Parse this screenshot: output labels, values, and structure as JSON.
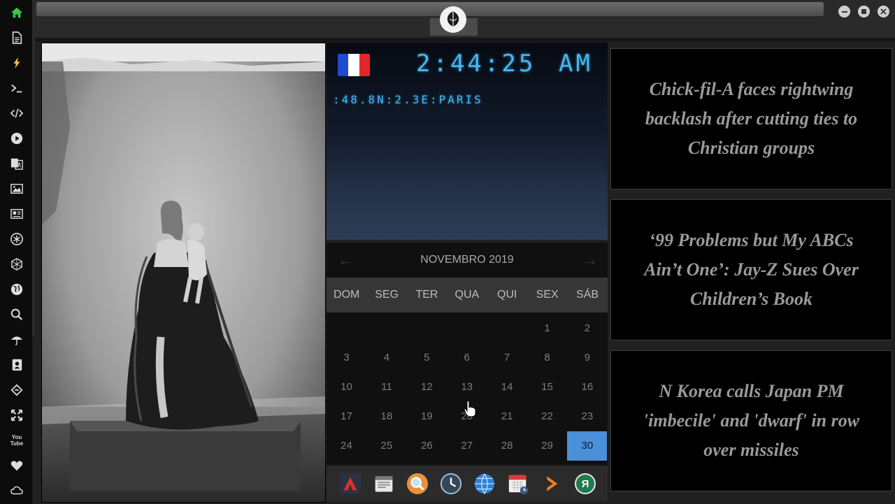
{
  "sidebar": {
    "icons": [
      "home-icon",
      "document-icon",
      "lightning-icon",
      "terminal-icon",
      "code-icon",
      "play-icon",
      "translate-icon",
      "image-icon",
      "news-icon",
      "rebel-icon",
      "hexagon-icon",
      "globe-icon",
      "search-icon",
      "umbrella-icon",
      "contacts-icon",
      "hash-icon",
      "expand-icon",
      "youtube-icon",
      "heart-icon",
      "cloud-icon"
    ],
    "youtube_label": "You Tube"
  },
  "clock": {
    "time": "2:44:25",
    "ampm": "AM",
    "location": ":48.8N:2.3E:PARIS",
    "flag_colors": [
      "#1e4bd2",
      "#ffffff",
      "#e2262e"
    ]
  },
  "calendar": {
    "month_label": "NOVEMBRO 2019",
    "weekdays": [
      "DOM",
      "SEG",
      "TER",
      "QUA",
      "QUI",
      "SEX",
      "SÁB"
    ],
    "first_weekday_index": 5,
    "days_in_month": 30,
    "today": 30,
    "today_color": "#4a90d9"
  },
  "dock": {
    "icons": [
      "adobe-icon",
      "calendar-list-icon",
      "magnifier-icon",
      "clock-icon",
      "globe-icon",
      "calendar-icon",
      "arrow-icon",
      "yandex-icon"
    ],
    "yandex_label": "Я"
  },
  "news": [
    {
      "headline": "Chick-fil-A faces rightwing backlash after cutting ties to Christian groups"
    },
    {
      "headline": "‘99 Problems but My ABCs Ain’t One’: Jay-Z Sues Over Children’s Book"
    },
    {
      "headline": "N Korea calls Japan PM 'imbecile' and 'dwarf' in row over missiles"
    }
  ]
}
